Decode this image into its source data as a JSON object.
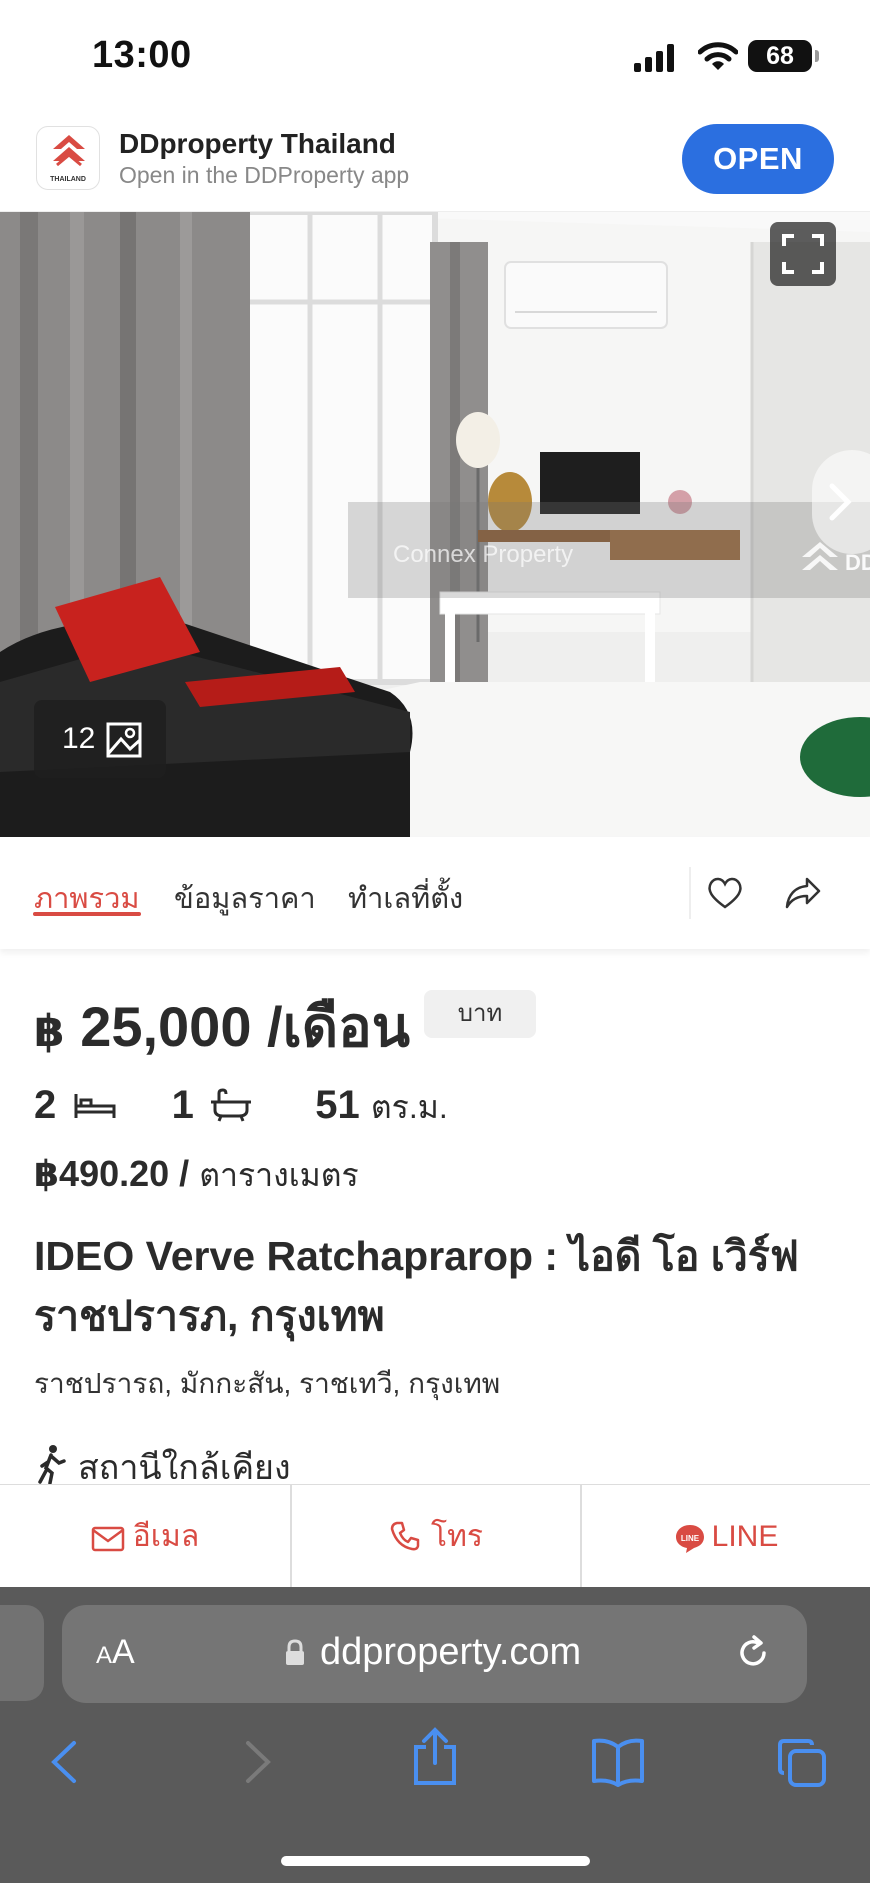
{
  "status_bar": {
    "time": "13:00",
    "battery": "68"
  },
  "app_banner": {
    "title": "DDproperty Thailand",
    "subtitle": "Open in the DDProperty app",
    "open_label": "OPEN",
    "logo_text": "THAILAND"
  },
  "gallery": {
    "photo_count": "12",
    "watermark": "Connex Property",
    "watermark_brand": "DD"
  },
  "tabs": [
    {
      "label": "ภาพรวม",
      "active": true
    },
    {
      "label": "ข้อมูลราคา",
      "active": false
    },
    {
      "label": "ทำเลที่ตั้ง",
      "active": false
    }
  ],
  "listing": {
    "currency_symbol": "฿",
    "price": "25,000 /เดือน",
    "unit_chip": "บาท",
    "bedrooms": "2",
    "bathrooms": "1",
    "area": "51",
    "area_unit": "ตร.ม.",
    "price_per_sqm": "฿490.20 /",
    "price_per_sqm_unit": "ตารางเมตร",
    "title": "IDEO Verve Ratchaprarop : ไอดี โอ เวิร์ฟ ราชปรารภ, กรุงเทพ",
    "address": "ราชปรารถ, มักกะสัน, ราชเทวี, กรุงเทพ",
    "nearby_label": "สถานีใกล้เคียง"
  },
  "actions": {
    "email": "อีเมล",
    "call": "โทร",
    "line": "LINE"
  },
  "browser": {
    "aa_small": "A",
    "aa_large": "A",
    "domain": "ddproperty.com"
  },
  "colors": {
    "accent": "#d94b43",
    "open_button": "#2b6fe0",
    "safari_icons": "#4a8ff0"
  }
}
